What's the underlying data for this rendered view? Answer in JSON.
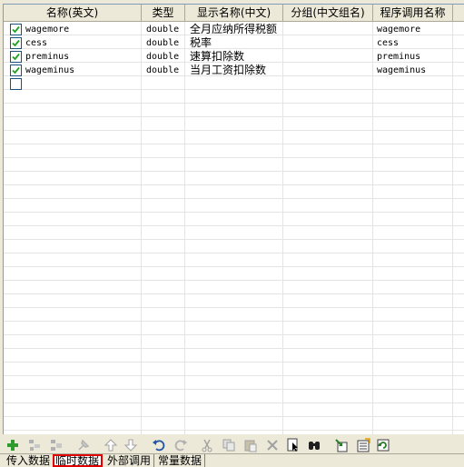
{
  "columns": [
    {
      "label": "名称(英文)"
    },
    {
      "label": "类型"
    },
    {
      "label": "显示名称(中文)"
    },
    {
      "label": "分组(中文组名)"
    },
    {
      "label": "程序调用名称"
    }
  ],
  "rows": [
    {
      "checked": true,
      "name": "wagemore",
      "type": "double",
      "display": "全月应纳所得税额",
      "group": "",
      "call_name": "wagemore"
    },
    {
      "checked": true,
      "name": "cess",
      "type": "double",
      "display": "税率",
      "group": "",
      "call_name": "cess"
    },
    {
      "checked": true,
      "name": "preminus",
      "type": "double",
      "display": "速算扣除数",
      "group": "",
      "call_name": "preminus"
    },
    {
      "checked": true,
      "name": "wageminus",
      "type": "double",
      "display": "当月工资扣除数",
      "group": "",
      "call_name": "wageminus"
    },
    {
      "checked": false,
      "name": "",
      "type": "",
      "display": "",
      "group": "",
      "call_name": ""
    }
  ],
  "toolbar_icons": [
    "add-icon",
    "add-child-icon",
    "insert-icon",
    "pin-icon",
    "move-up-icon",
    "move-down-icon",
    "undo-icon",
    "redo-icon",
    "cut-icon",
    "copy-icon",
    "paste-icon",
    "delete-icon",
    "select-icon",
    "find-icon",
    "import-icon",
    "export-icon",
    "refresh-icon"
  ],
  "tabs": [
    {
      "label": "传入数据",
      "active": false
    },
    {
      "label": "临时数据",
      "active": true
    },
    {
      "label": "外部调用",
      "active": false
    },
    {
      "label": "常量数据",
      "active": false
    }
  ],
  "colors": {
    "active_tab_outline": "#e00000",
    "check_green": "#21a121",
    "add_green": "#2e9b2e"
  }
}
